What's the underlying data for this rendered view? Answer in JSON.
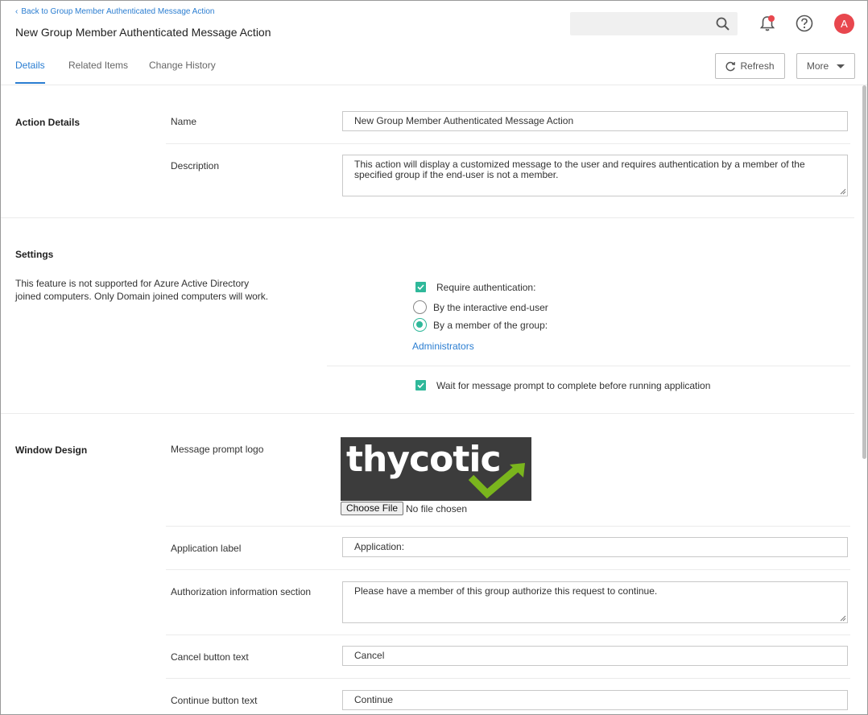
{
  "header": {
    "back_link": "Back to Group Member Authenticated Message Action",
    "title": "New Group Member Authenticated Message Action",
    "search_placeholder": "",
    "avatar_initial": "A"
  },
  "tabs": [
    {
      "label": "Details",
      "active": true
    },
    {
      "label": "Related Items",
      "active": false
    },
    {
      "label": "Change History",
      "active": false
    }
  ],
  "toolbar": {
    "refresh_label": "Refresh",
    "more_label": "More"
  },
  "action_details": {
    "section_title": "Action Details",
    "name_label": "Name",
    "name_value": "New Group Member Authenticated Message Action",
    "description_label": "Description",
    "description_value": "This action will display a customized message to the user and requires authentication by a member of the specified group if the end-user is not a member."
  },
  "settings": {
    "section_title": "Settings",
    "note": "This feature is not supported for Azure Active Directory joined computers. Only Domain joined computers will work.",
    "require_auth_label": "Require authentication:",
    "require_auth_checked": true,
    "radio_options": [
      {
        "label": "By the interactive end-user",
        "checked": false
      },
      {
        "label": "By a member of the group:",
        "checked": true
      }
    ],
    "group_link": "Administrators",
    "wait_label": "Wait for message prompt to complete before running application",
    "wait_checked": true
  },
  "window_design": {
    "section_title": "Window Design",
    "logo_label": "Message prompt logo",
    "logo_text": "thycotic",
    "choose_file_label": "Choose File",
    "file_status": "No file chosen",
    "app_label_label": "Application label",
    "app_label_value": "Application:",
    "auth_info_label": "Authorization information section",
    "auth_info_value": "Please have a member of this group authorize this request to continue.",
    "cancel_label": "Cancel button text",
    "cancel_value": "Cancel",
    "continue_label": "Continue button text",
    "continue_value": "Continue"
  },
  "colors": {
    "accent": "#2a7dd1",
    "check": "#2fb89a",
    "avatar": "#e8474e",
    "logo_bg": "#3c3c3c",
    "logo_check": "#7ab51d"
  }
}
